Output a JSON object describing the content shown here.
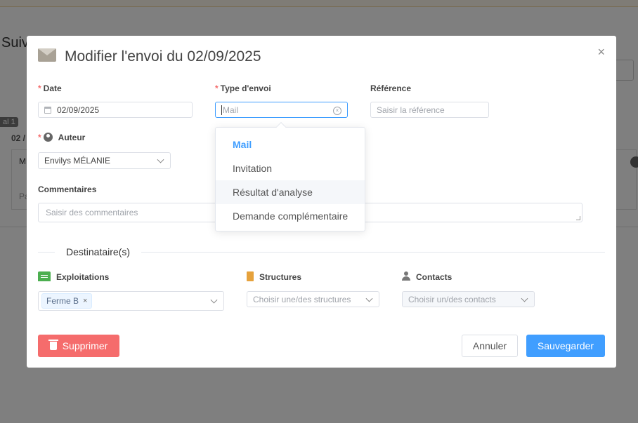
{
  "background": {
    "title": "Suivi",
    "tag": "al 1",
    "date": "02 /",
    "card_left": "M",
    "card_bottom": "Pa"
  },
  "modal": {
    "title": "Modifier l'envoi du 02/09/2025",
    "close": "×"
  },
  "form": {
    "date": {
      "label": "Date",
      "value": "02/09/2025"
    },
    "type": {
      "label": "Type d'envoi",
      "placeholder": "Mail"
    },
    "reference": {
      "label": "Référence",
      "placeholder": "Saisir la référence"
    },
    "author": {
      "label": "Auteur",
      "value": "Envilys MÉLANIE"
    },
    "comments": {
      "label": "Commentaires",
      "placeholder": "Saisir des commentaires"
    }
  },
  "recipients": {
    "title": "Destinataire(s)",
    "exploitations": {
      "label": "Exploitations",
      "tags": [
        "Ferme B"
      ]
    },
    "structures": {
      "label": "Structures",
      "placeholder": "Choisir une/des structures"
    },
    "contacts": {
      "label": "Contacts",
      "placeholder": "Choisir un/des contacts"
    }
  },
  "buttons": {
    "delete": "Supprimer",
    "cancel": "Annuler",
    "save": "Sauvegarder"
  },
  "dropdown": {
    "options": [
      "Mail",
      "Invitation",
      "Résultat d'analyse",
      "Demande complémentaire"
    ],
    "selected": "Mail",
    "hovered": "Résultat d'analyse"
  },
  "colors": {
    "primary": "#409eff",
    "danger": "#f56c6c",
    "required": "#f56c6c",
    "exploitation_icon": "#4caf50",
    "structure_icon": "#e6a23c"
  }
}
